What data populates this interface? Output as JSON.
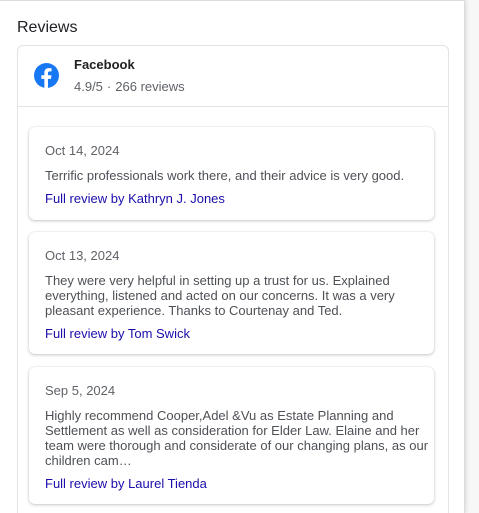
{
  "section": {
    "title": "Reviews"
  },
  "source": {
    "name": "Facebook",
    "rating": "4.9/5",
    "separator": "·",
    "count": "266 reviews",
    "icon": "facebook-icon",
    "brand_color": "#1877F2"
  },
  "reviews": [
    {
      "date": "Oct 14, 2024",
      "text": "Terrific professionals work there, and their advice is very good.",
      "link": "Full review by Kathryn J. Jones"
    },
    {
      "date": "Oct 13, 2024",
      "text": "They were very helpful in setting up a trust for us. Explained everything, listened and acted on our concerns. It was a very pleasant experience. Thanks to Courtenay and Ted.",
      "link": "Full review by Tom Swick"
    },
    {
      "date": "Sep 5, 2024",
      "text": "Highly recommend Cooper,Adel &Vu as Estate Planning and Settlement as well as consideration for Elder Law. Elaine and her team were thorough and considerate of our changing plans, as our children cam…",
      "link": "Full review by Laurel Tienda"
    }
  ],
  "colors": {
    "link": "#1a0dab",
    "muted_text": "#5f6368",
    "body_text": "#4d5156"
  }
}
